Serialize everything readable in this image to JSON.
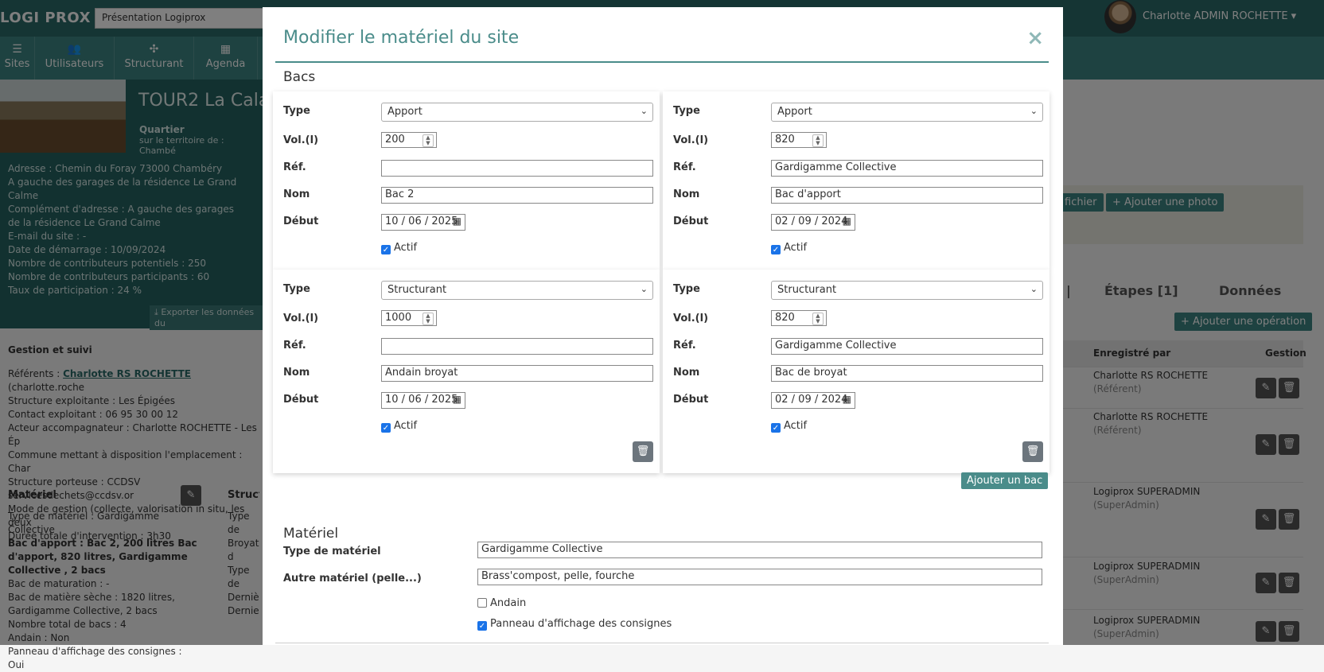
{
  "app": {
    "brand": "LOGI PROX -",
    "presentation_select": "Présentation Logiprox",
    "user_name": "Charlotte ADMIN ROCHETTE",
    "nav": [
      {
        "label": "Sites",
        "icon": "sites-icon"
      },
      {
        "label": "Utilisateurs",
        "icon": "users-icon"
      },
      {
        "label": "Structurant",
        "icon": "structurant-icon"
      },
      {
        "label": "Agenda",
        "icon": "calendar-icon"
      }
    ]
  },
  "site": {
    "title": "TOUR2 La Cala",
    "quartier_label": "Quartier",
    "territoire": "sur le territoire de : Chambé",
    "lines": [
      "Adresse : Chemin du Foray 73000 Chambéry",
      "A gauche des garages de la résidence Le Grand",
      "Calme",
      "Complément d'adresse : A gauche des garages",
      "de la résidence Le Grand Calme",
      "E-mail du site : -",
      "Date de démarrage : 10/09/2024",
      "Nombre de contributeurs potentiels : 250",
      "Nombre de contributeurs participants : 60",
      "Taux de participation : 24 %"
    ],
    "export_label": "Exporter les données du"
  },
  "gestion": {
    "title": "Gestion et suivi",
    "referents_label": "Référents : ",
    "referents_link": "Charlotte RS ROCHETTE",
    "referents_rest": " (charlotte.roche",
    "lines": [
      "Structure exploitante : Les Épigées",
      "Contact exploitant : 06 95 30 00 12",
      "Acteur accompagnateur : Charlotte ROCHETTE - Les Ép",
      "Commune mettant à disposition l'emplacement : Char",
      "Structure porteuse : CCDSV servicesdechets@ccdsv.or",
      "Mode de gestion (collecte, valorisation in situ, les deux",
      "Durée totale d'intervention : 3h30"
    ]
  },
  "materiel_bg": {
    "title": "Matériel",
    "lines": [
      "Type de matériel : Gardigamme Collective",
      "Bac d'apport : Bac 2, 200 litres Bac",
      "d'apport, 820 litres, Gardigamme",
      "Collective , 2 bacs",
      "Bac de maturation : -",
      "Bac de matière sèche : 1820 litres,",
      "Gardigamme Collective, 2 bacs",
      "Nombre total de bacs : 4",
      "Andain : Non",
      "Panneau d'affichage des consignes : Oui"
    ],
    "struct_title": "Structu",
    "struct_lines": [
      "Type de",
      "Broyat d",
      "Type de",
      "Dernièr",
      "Dernier"
    ]
  },
  "right_bg": {
    "add_file": "fichier",
    "add_photo": "Ajouter une photo",
    "tab_etapes": "Étapes [1]",
    "tab_donnees": "Données",
    "add_operation": "Ajouter une opération",
    "col_enregistre": "Enregistré par",
    "col_gestion": "Gestion",
    "records": [
      {
        "name": "Charlotte RS ROCHETTE",
        "role": "(Référent)"
      },
      {
        "name": "Charlotte RS ROCHETTE",
        "role": "(Référent)"
      },
      {
        "name": "Logiprox SUPERADMIN",
        "role": "(SuperAdmin)"
      },
      {
        "name": "Logiprox SUPERADMIN",
        "role": "(SuperAdmin)"
      },
      {
        "name": "Logiprox SUPERADMIN",
        "role": "(SuperAdmin)"
      }
    ]
  },
  "modal": {
    "title": "Modifier le matériel du site",
    "close": "×",
    "bacs_section": "Bacs",
    "labels": {
      "type": "Type",
      "vol": "Vol.(l)",
      "ref": "Réf.",
      "nom": "Nom",
      "debut": "Début",
      "actif": "Actif"
    },
    "bacs": [
      {
        "type": "Apport",
        "vol": "200",
        "ref": "",
        "nom": "Bac 2",
        "debut": "10 / 06 / 2025",
        "actif": true
      },
      {
        "type": "Apport",
        "vol": "820",
        "ref": "Gardigamme Collective",
        "nom": "Bac d'apport",
        "debut": "02 / 09 / 2024",
        "actif": true
      },
      {
        "type": "Structurant",
        "vol": "1000",
        "ref": "",
        "nom": "Andain broyat",
        "debut": "10 / 06 / 2025",
        "actif": true
      },
      {
        "type": "Structurant",
        "vol": "820",
        "ref": "Gardigamme Collective",
        "nom": "Bac de broyat",
        "debut": "02 / 09 / 2024",
        "actif": true
      }
    ],
    "add_bac": "Ajouter un bac",
    "materiel_section": "Matériel",
    "type_materiel_label": "Type de matériel",
    "type_materiel_value": "Gardigamme Collective",
    "autre_label": "Autre matériel (pelle...)",
    "autre_value": "Brass'compost, pelle, fourche",
    "andain_label": "Andain",
    "andain_checked": false,
    "panneau_label": "Panneau d'affichage des consignes",
    "panneau_checked": true
  }
}
